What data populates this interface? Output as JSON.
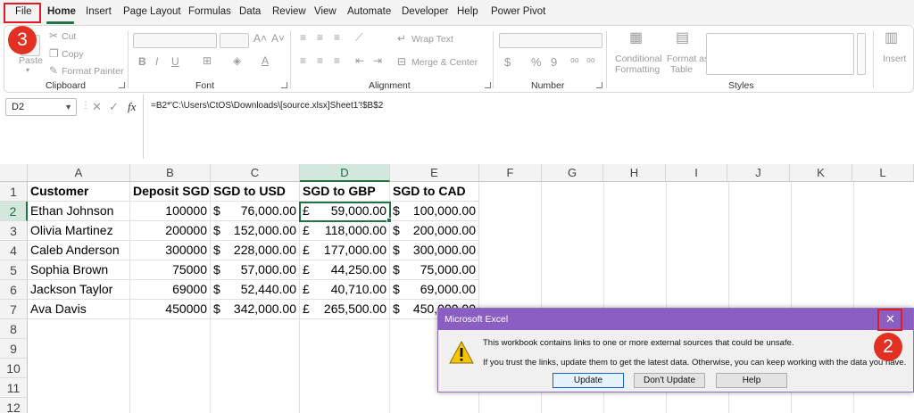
{
  "menu": {
    "tabs": [
      "File",
      "Home",
      "Insert",
      "Page Layout",
      "Formulas",
      "Data",
      "Review",
      "View",
      "Automate",
      "Developer",
      "Help",
      "Power Pivot"
    ],
    "active": "Home"
  },
  "ribbon": {
    "clipboard": {
      "paste": "Paste",
      "cut": "Cut",
      "copy": "Copy",
      "format_painter": "Format Painter",
      "label": "Clipboard"
    },
    "font": {
      "label": "Font",
      "bold": "B",
      "italic": "I",
      "underline": "U"
    },
    "alignment": {
      "wrap_text": "Wrap Text",
      "merge_center": "Merge & Center",
      "label": "Alignment"
    },
    "number": {
      "currency": "$",
      "percent": "%",
      "comma": "9",
      "label": "Number"
    },
    "styles": {
      "conditional_formatting_1": "Conditional",
      "conditional_formatting_2": "Formatting",
      "format_table_1": "Format as",
      "format_table_2": "Table",
      "label": "Styles"
    },
    "cells": {
      "insert": "Insert"
    }
  },
  "formula_bar": {
    "name_box": "D2",
    "fx": "fx",
    "formula": "=B2*'C:\\Users\\CtOS\\Downloads\\[source.xlsx]Sheet1'!$B$2"
  },
  "sheet": {
    "columns": [
      "A",
      "B",
      "C",
      "D",
      "E",
      "F",
      "G",
      "H",
      "I",
      "J",
      "K",
      "L"
    ],
    "selected_column": "D",
    "selected_row": 2,
    "row_numbers": [
      "1",
      "2",
      "3",
      "4",
      "5",
      "6",
      "7",
      "8",
      "9",
      "10",
      "11",
      "12"
    ],
    "headers": [
      "Customer",
      "Deposit SGD",
      "SGD to USD",
      "SGD to GBP",
      "SGD to CAD"
    ],
    "rows": [
      {
        "customer": "Ethan Johnson",
        "deposit": "100000",
        "usd_sym": "$",
        "usd": "76,000.00",
        "gbp_sym": "£",
        "gbp": "59,000.00",
        "cad_sym": "$",
        "cad": "100,000.00"
      },
      {
        "customer": "Olivia Martinez",
        "deposit": "200000",
        "usd_sym": "$",
        "usd": "152,000.00",
        "gbp_sym": "£",
        "gbp": "118,000.00",
        "cad_sym": "$",
        "cad": "200,000.00"
      },
      {
        "customer": "Caleb Anderson",
        "deposit": "300000",
        "usd_sym": "$",
        "usd": "228,000.00",
        "gbp_sym": "£",
        "gbp": "177,000.00",
        "cad_sym": "$",
        "cad": "300,000.00"
      },
      {
        "customer": "Sophia Brown",
        "deposit": "75000",
        "usd_sym": "$",
        "usd": "57,000.00",
        "gbp_sym": "£",
        "gbp": "44,250.00",
        "cad_sym": "$",
        "cad": "75,000.00"
      },
      {
        "customer": "Jackson Taylor",
        "deposit": "69000",
        "usd_sym": "$",
        "usd": "52,440.00",
        "gbp_sym": "£",
        "gbp": "40,710.00",
        "cad_sym": "$",
        "cad": "69,000.00"
      },
      {
        "customer": "Ava Davis",
        "deposit": "450000",
        "usd_sym": "$",
        "usd": "342,000.00",
        "gbp_sym": "£",
        "gbp": "265,500.00",
        "cad_sym": "$",
        "cad": "450,000.00"
      }
    ]
  },
  "dialog": {
    "title": "Microsoft Excel",
    "close": "✕",
    "message_1": "This workbook contains links to one or more external sources that could be unsafe.",
    "message_2": "If you trust the links, update them to get the latest data. Otherwise, you can keep working with the data you have.",
    "buttons": {
      "update": "Update",
      "dont_update": "Don't Update",
      "help": "Help"
    }
  },
  "annotations": {
    "step_file": "3",
    "step_close": "2"
  },
  "colors": {
    "accent_green": "#217346",
    "dialog_title": "#8a5fc1",
    "highlight_red": "#e01b24"
  }
}
